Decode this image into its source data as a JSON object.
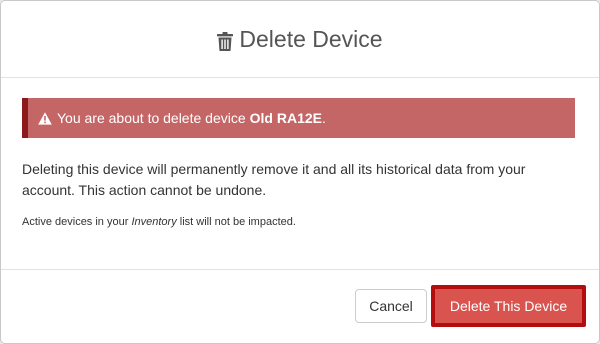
{
  "dialog": {
    "title": "Delete Device",
    "title_icon": "trash-icon"
  },
  "alert": {
    "icon": "warning-icon",
    "text_prefix": "You are about to delete device",
    "device_name": "Old RA12E",
    "text_suffix": "."
  },
  "body": {
    "warning_text": "Deleting this device will permanently remove it and all its historical data from your account. This action cannot be undone.",
    "note_prefix": "Active devices in your",
    "note_emphasis": "Inventory",
    "note_suffix": "list will not be impacted."
  },
  "footer": {
    "cancel_label": "Cancel",
    "delete_label": "Delete This Device"
  },
  "colors": {
    "alert_bg": "#c56666",
    "alert_border": "#8c1a1a",
    "delete_bg": "#d9534f",
    "delete_border": "#b30d0d"
  }
}
